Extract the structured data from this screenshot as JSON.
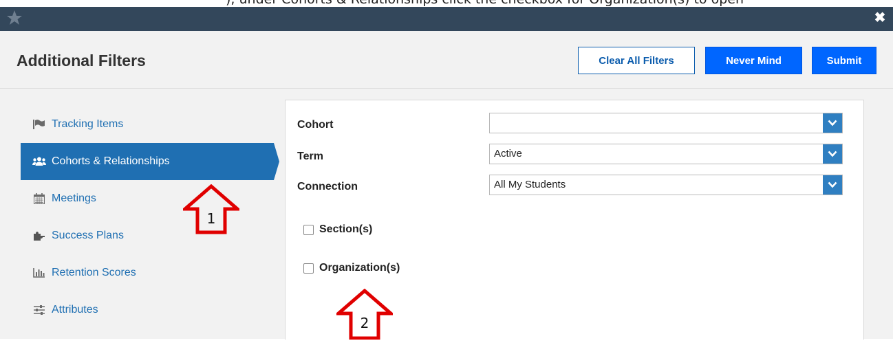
{
  "caption": {
    "text": "), under Cohorts & Relationships click the checkbox for Organization(s) to open"
  },
  "window": {
    "close_glyph": "✖"
  },
  "header": {
    "title": "Additional Filters",
    "buttons": {
      "clear_all": "Clear All Filters",
      "never_mind": "Never Mind",
      "submit": "Submit"
    }
  },
  "sidebar": {
    "items": [
      {
        "label": "Tracking Items",
        "icon": "flag-icon",
        "active": false
      },
      {
        "label": "Cohorts & Relationships",
        "icon": "users-icon",
        "active": true
      },
      {
        "label": "Meetings",
        "icon": "calendar-icon",
        "active": false
      },
      {
        "label": "Success Plans",
        "icon": "puzzle-icon",
        "active": false
      },
      {
        "label": "Retention Scores",
        "icon": "bar-chart-icon",
        "active": false
      },
      {
        "label": "Attributes",
        "icon": "sliders-icon",
        "active": false
      }
    ]
  },
  "filters": {
    "cohort": {
      "label": "Cohort",
      "value": ""
    },
    "term": {
      "label": "Term",
      "value": "Active"
    },
    "connection": {
      "label": "Connection",
      "value": "All My Students"
    },
    "sections": {
      "label": "Section(s)",
      "checked": false
    },
    "organizations": {
      "label": "Organization(s)",
      "checked": false
    }
  },
  "annotations": {
    "callout_1": {
      "number": "1"
    },
    "callout_2": {
      "number": "2"
    }
  },
  "colors": {
    "titlebar": "#33475b",
    "accent": "#1f6fb2",
    "primary_button": "#0066ff",
    "callout_arrow": "#e00000"
  }
}
